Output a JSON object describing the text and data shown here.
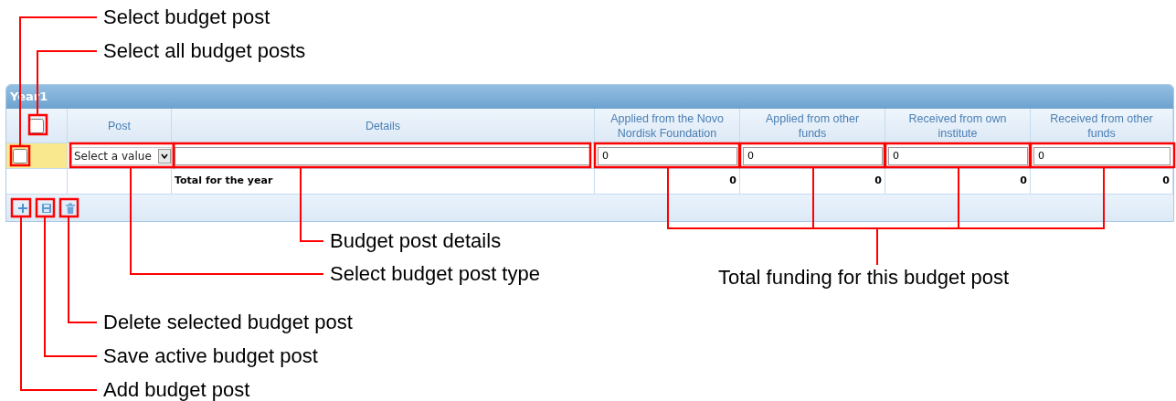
{
  "panel": {
    "title": "Year1"
  },
  "table": {
    "select_all": {
      "checked": false
    },
    "columns": [
      "Post",
      "Details",
      "Applied from the Novo Nordisk Foundation",
      "Applied from other funds",
      "Received from own institute",
      "Received from other funds"
    ],
    "rows": [
      {
        "checked": false,
        "post": {
          "placeholder": "Select a value"
        },
        "amounts": [
          "0",
          "0",
          "0",
          "0"
        ]
      }
    ],
    "total": {
      "label": "Total for the year",
      "values": [
        "0",
        "0",
        "0",
        "0"
      ]
    }
  },
  "toolbar": [
    {
      "kind": "add"
    },
    {
      "kind": "save"
    },
    {
      "kind": "delete"
    }
  ],
  "annotations": [
    {
      "text": "Select budget post"
    },
    {
      "text": "Select all budget posts"
    },
    {
      "text": "Budget post details"
    },
    {
      "text": "Select budget post type"
    },
    {
      "text": "Total funding for this budget post"
    },
    {
      "text": "Delete selected budget post"
    },
    {
      "text": "Save active budget post"
    },
    {
      "text": "Add budget post"
    }
  ]
}
